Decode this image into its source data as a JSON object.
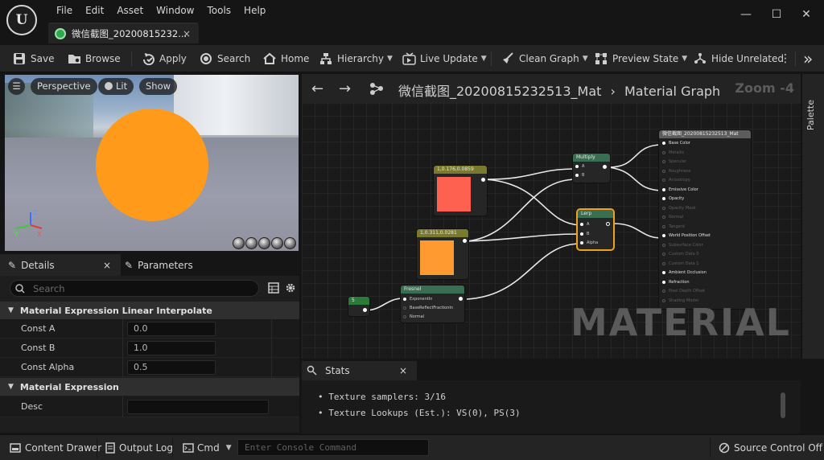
{
  "app": {
    "logo_text": "U",
    "menu": [
      "File",
      "Edit",
      "Asset",
      "Window",
      "Tools",
      "Help"
    ],
    "window_controls": {
      "minimize": "—",
      "maximize": "☐",
      "close": "✕"
    },
    "asset_tab": {
      "label": "微信截图_20200815232...",
      "close": "×"
    }
  },
  "toolbar": {
    "save": "Save",
    "browse": "Browse",
    "apply": "Apply",
    "search": "Search",
    "home": "Home",
    "hierarchy": "Hierarchy",
    "live_update": "Live Update",
    "clean_graph": "Clean Graph",
    "preview_state": "Preview State",
    "hide_unrelated": "Hide Unrelated",
    "more": "⋮",
    "expand": "»"
  },
  "viewport": {
    "perspective": "Perspective",
    "lit": "Lit",
    "show": "Show",
    "sphere_color": "#ff9a1a"
  },
  "details": {
    "tab_details": "Details",
    "tab_parameters": "Parameters",
    "close": "×",
    "search_placeholder": "Search",
    "section1": "Material Expression Linear Interpolate",
    "const_a_label": "Const A",
    "const_a": "0.0",
    "const_b_label": "Const B",
    "const_b": "1.0",
    "const_alpha_label": "Const Alpha",
    "const_alpha": "0.5",
    "section2": "Material Expression",
    "desc_label": "Desc",
    "desc_value": ""
  },
  "graph": {
    "title": "微信截图_20200815232513_Mat",
    "breadcrumb_sep": "›",
    "subtitle": "Material Graph",
    "zoom": "Zoom -4",
    "watermark": "MATERIAL",
    "palette": "Palette",
    "nodes": {
      "const1": {
        "title": "1,0.176,0.0859",
        "color": "#ff6150"
      },
      "const2": {
        "title": "1,0.311,0.0281",
        "color": "#ff9a30"
      },
      "scalar": {
        "title": "5"
      },
      "multiply": {
        "title": "Multiply",
        "pins": [
          "A",
          "B"
        ]
      },
      "lerp": {
        "title": "Lerp",
        "pins": [
          "A",
          "B",
          "Alpha"
        ]
      },
      "fresnel": {
        "title": "Fresnel",
        "pins": [
          "ExponentIn",
          "BaseReflectFractionIn",
          "Normal"
        ]
      },
      "result": {
        "title": "微信截图_20200815232513_Mat",
        "pins": [
          {
            "label": "Base Color",
            "active": true
          },
          {
            "label": "Metallic",
            "active": false
          },
          {
            "label": "Specular",
            "active": false
          },
          {
            "label": "Roughness",
            "active": false
          },
          {
            "label": "Anisotropy",
            "active": false
          },
          {
            "label": "Emissive Color",
            "active": true
          },
          {
            "label": "Opacity",
            "active": true
          },
          {
            "label": "Opacity Mask",
            "active": false
          },
          {
            "label": "Normal",
            "active": false
          },
          {
            "label": "Tangent",
            "active": false
          },
          {
            "label": "World Position Offset",
            "active": true
          },
          {
            "label": "Subsurface Color",
            "active": false
          },
          {
            "label": "Custom Data 0",
            "active": false
          },
          {
            "label": "Custom Data 1",
            "active": false
          },
          {
            "label": "Ambient Occlusion",
            "active": true
          },
          {
            "label": "Refraction",
            "active": true
          },
          {
            "label": "Pixel Depth Offset",
            "active": false
          },
          {
            "label": "Shading Model",
            "active": false
          }
        ]
      }
    }
  },
  "stats": {
    "tab": "Stats",
    "close": "×",
    "line1": "•  Texture samplers: 3/16",
    "line2": "•  Texture Lookups (Est.): VS(0), PS(3)"
  },
  "statusbar": {
    "content_drawer": "Content Drawer",
    "output_log": "Output Log",
    "cmd": "Cmd",
    "console_placeholder": "Enter Console Command",
    "source_control": "Source Control Off"
  }
}
